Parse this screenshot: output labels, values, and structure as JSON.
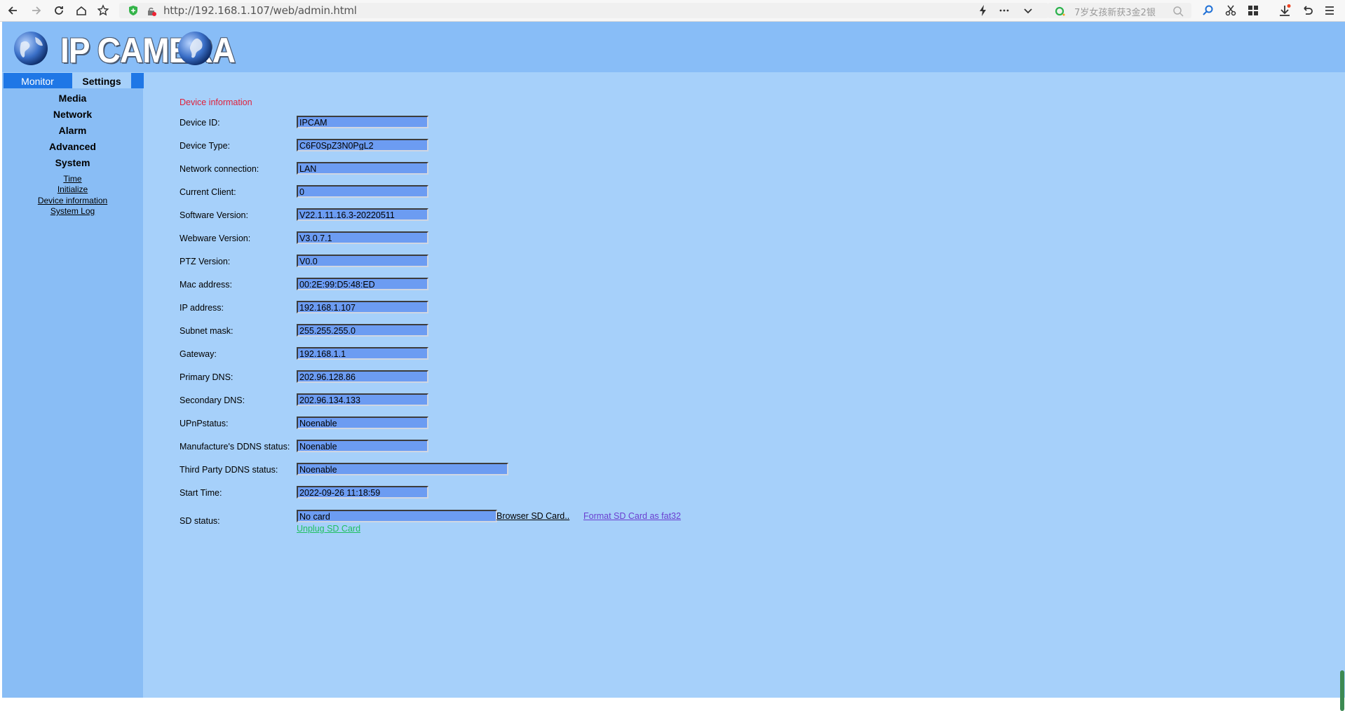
{
  "browser": {
    "url": "http://192.168.1.107/web/admin.html",
    "search_placeholder": "7岁女孩新获3金2银"
  },
  "header": {
    "logo_text": "IP CAMERA"
  },
  "tabs": {
    "monitor": "Monitor",
    "settings": "Settings"
  },
  "sidebar": {
    "menu": [
      "Media",
      "Network",
      "Alarm",
      "Advanced",
      "System"
    ],
    "system_links": [
      "Time",
      "Initialize",
      "Device information",
      "System Log"
    ]
  },
  "device_info": {
    "title": "Device information",
    "rows": [
      {
        "label": "Device ID:",
        "value": "IPCAM"
      },
      {
        "label": "Device Type:",
        "value": "C6F0SpZ3N0PgL2"
      },
      {
        "label": "Network connection:",
        "value": "LAN"
      },
      {
        "label": "Current Client:",
        "value": "0"
      },
      {
        "label": "Software Version:",
        "value": "V22.1.11.16.3-20220511"
      },
      {
        "label": "Webware Version:",
        "value": "V3.0.7.1"
      },
      {
        "label": "PTZ Version:",
        "value": "V0.0"
      },
      {
        "label": "Mac address:",
        "value": "00:2E:99:D5:48:ED"
      },
      {
        "label": "IP address:",
        "value": "192.168.1.107"
      },
      {
        "label": "Subnet mask:",
        "value": "255.255.255.0"
      },
      {
        "label": "Gateway:",
        "value": "192.168.1.1"
      },
      {
        "label": "Primary DNS:",
        "value": "202.96.128.86"
      },
      {
        "label": "Secondary DNS:",
        "value": "202.96.134.133"
      },
      {
        "label": "UPnPstatus:",
        "value": "Noenable"
      },
      {
        "label": "Manufacture's DDNS status:",
        "value": "Noenable"
      },
      {
        "label": "Third Party DDNS status:",
        "value": "Noenable"
      },
      {
        "label": "Start Time:",
        "value": "2022-09-26 11:18:59"
      }
    ],
    "sd": {
      "label": "SD status:",
      "value": "No card",
      "browse_link": "Browser SD Card..",
      "format_link": "Format SD Card as fat32",
      "unplug_link": "Unplug SD Card"
    }
  },
  "colors": {
    "page_bg": "#a6d0fa",
    "header_bg": "#88bdf7",
    "sidebar_bg": "#89bdf5",
    "tab_active": "#1f77e6",
    "field_bg": "#6c9cf2",
    "section_title": "#e0203a",
    "format_link": "#6a3fd0",
    "unplug_link": "#20c060"
  }
}
